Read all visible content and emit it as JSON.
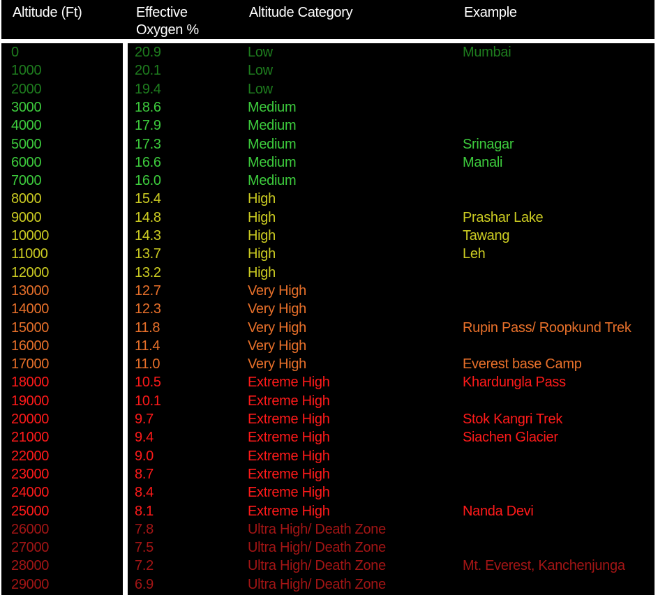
{
  "headers": {
    "altitude": "Altitude (Ft)",
    "oxygen_line1": "Effective",
    "oxygen_line2": "Oxygen %",
    "category": "Altitude Category",
    "example": "Example"
  },
  "colors": {
    "background": "#000000",
    "header_text": "#ffffff",
    "Low": "#1e7d1e",
    "Medium": "#3dcc3d",
    "High": "#cccc22",
    "Very High": "#e8702a",
    "Extreme High": "#ff1a1a",
    "Ultra High/ Death Zone": "#a31515"
  },
  "rows": [
    {
      "altitude": "0",
      "oxygen": "20.9",
      "category": "Low",
      "example": "Mumbai"
    },
    {
      "altitude": "1000",
      "oxygen": "20.1",
      "category": "Low",
      "example": ""
    },
    {
      "altitude": "2000",
      "oxygen": "19.4",
      "category": "Low",
      "example": ""
    },
    {
      "altitude": "3000",
      "oxygen": "18.6",
      "category": "Medium",
      "example": ""
    },
    {
      "altitude": "4000",
      "oxygen": "17.9",
      "category": "Medium",
      "example": ""
    },
    {
      "altitude": "5000",
      "oxygen": "17.3",
      "category": "Medium",
      "example": "Srinagar"
    },
    {
      "altitude": "6000",
      "oxygen": "16.6",
      "category": "Medium",
      "example": "Manali"
    },
    {
      "altitude": "7000",
      "oxygen": "16.0",
      "category": "Medium",
      "example": ""
    },
    {
      "altitude": "8000",
      "oxygen": "15.4",
      "category": "High",
      "example": ""
    },
    {
      "altitude": "9000",
      "oxygen": "14.8",
      "category": "High",
      "example": "Prashar Lake"
    },
    {
      "altitude": "10000",
      "oxygen": "14.3",
      "category": "High",
      "example": "Tawang"
    },
    {
      "altitude": "11000",
      "oxygen": "13.7",
      "category": "High",
      "example": "Leh"
    },
    {
      "altitude": "12000",
      "oxygen": "13.2",
      "category": "High",
      "example": ""
    },
    {
      "altitude": "13000",
      "oxygen": "12.7",
      "category": "Very High",
      "example": ""
    },
    {
      "altitude": "14000",
      "oxygen": "12.3",
      "category": "Very High",
      "example": ""
    },
    {
      "altitude": "15000",
      "oxygen": "11.8",
      "category": "Very High",
      "example": "Rupin Pass/ Roopkund Trek"
    },
    {
      "altitude": "16000",
      "oxygen": "11.4",
      "category": "Very High",
      "example": ""
    },
    {
      "altitude": "17000",
      "oxygen": "11.0",
      "category": "Very High",
      "example": "Everest base Camp"
    },
    {
      "altitude": "18000",
      "oxygen": "10.5",
      "category": "Extreme High",
      "example": "Khardungla Pass"
    },
    {
      "altitude": "19000",
      "oxygen": "10.1",
      "category": "Extreme High",
      "example": ""
    },
    {
      "altitude": "20000",
      "oxygen": "9.7",
      "category": "Extreme High",
      "example": "Stok Kangri Trek"
    },
    {
      "altitude": "21000",
      "oxygen": "9.4",
      "category": "Extreme High",
      "example": "Siachen Glacier"
    },
    {
      "altitude": "22000",
      "oxygen": "9.0",
      "category": "Extreme High",
      "example": ""
    },
    {
      "altitude": "23000",
      "oxygen": "8.7",
      "category": "Extreme High",
      "example": ""
    },
    {
      "altitude": "24000",
      "oxygen": "8.4",
      "category": "Extreme High",
      "example": ""
    },
    {
      "altitude": "25000",
      "oxygen": "8.1",
      "category": "Extreme High",
      "example": "Nanda Devi"
    },
    {
      "altitude": "26000",
      "oxygen": "7.8",
      "category": "Ultra High/ Death Zone",
      "example": ""
    },
    {
      "altitude": "27000",
      "oxygen": "7.5",
      "category": "Ultra High/ Death Zone",
      "example": ""
    },
    {
      "altitude": "28000",
      "oxygen": "7.2",
      "category": "Ultra High/ Death Zone",
      "example": "Mt. Everest, Kanchenjunga"
    },
    {
      "altitude": "29000",
      "oxygen": "6.9",
      "category": "Ultra High/ Death Zone",
      "example": ""
    }
  ]
}
